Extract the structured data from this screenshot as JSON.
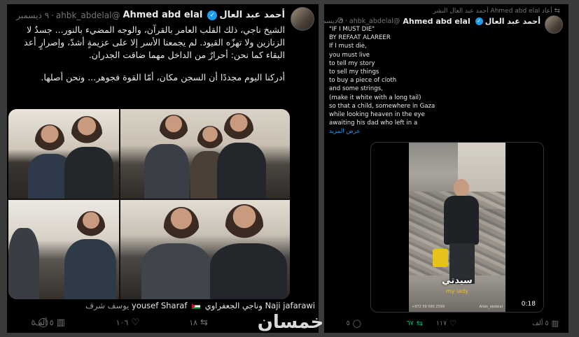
{
  "left_tweet": {
    "author_name_ar": "أحمد عبد العال",
    "author_name_en": "Ahmed abd elal",
    "handle": "@ahbk_abdelal",
    "date": "٩ ديسمبر",
    "body_lines": [
      "الشيخ ناجي، ذلك القلب العامر بالقرآن، والوجه المضيء بالنور... جسدٌ لا",
      "الزنازين ولا تهزّه القيود. لم يجمعنا الأسر إلا على عزيمةٍ أشدّ، وإصرارٍ أعد",
      "البقاء كما نحن: أحرارٌ من الداخل مهما ضاقت الجدران."
    ],
    "body_last": "أدركنا اليوم مجددًا أن السجن مكان، أمّا القوة فجوهر... ونحن أصلها.",
    "tags_first": "yousef Sharaf",
    "tags_muted": "يوسف شرف",
    "tags_mid": "وناجي الجعفراوي",
    "tags_last": "Naji jafarawi",
    "actions": {
      "replies": "٥",
      "retweets": "١٨",
      "likes": "١٠٦",
      "views": "٥ ألف"
    }
  },
  "right_tweet": {
    "retweeted_by": "أعاد Ahmed abd elal أحمد عبد العال النشر",
    "author_name_ar": "أحمد عبد العال",
    "author_name_en": "Ahmed abd elal",
    "handle": "@ahbk_abdelal",
    "date": "٦ ديسمبر",
    "poem_lines": [
      "\"IF I MUST DIE\"",
      "BY REFAAT ALAREER",
      "If I must die,",
      "you must live",
      "to tell my story",
      "to sell my things",
      "to buy a piece of cloth",
      "and some strings,",
      "(make it white with a long tail)",
      "so that a child, somewhere in Gaza",
      "while looking heaven in the eye",
      "awaiting his dad who left in a"
    ],
    "show_more": "عرض المزيد",
    "video": {
      "subtitle_ar": "سيدتي",
      "subtitle_en": "my lady",
      "credit_left": "+972 59 580 2599",
      "credit_right": "Ahbk_abdelal",
      "duration": "0:18"
    },
    "actions": {
      "replies": "٥",
      "retweets": "٦٧",
      "likes": "١١٧",
      "views": "٥ ألف"
    }
  },
  "watermark": "خمسان",
  "colors": {
    "accent": "#1d9bf0",
    "retweet_green": "#00ba7c",
    "muted": "#71767b",
    "text": "#e7e9ea"
  },
  "icons": [
    "verified-badge-icon",
    "reply-icon",
    "retweet-icon",
    "like-icon",
    "views-icon",
    "bookmark-icon",
    "share-icon"
  ]
}
